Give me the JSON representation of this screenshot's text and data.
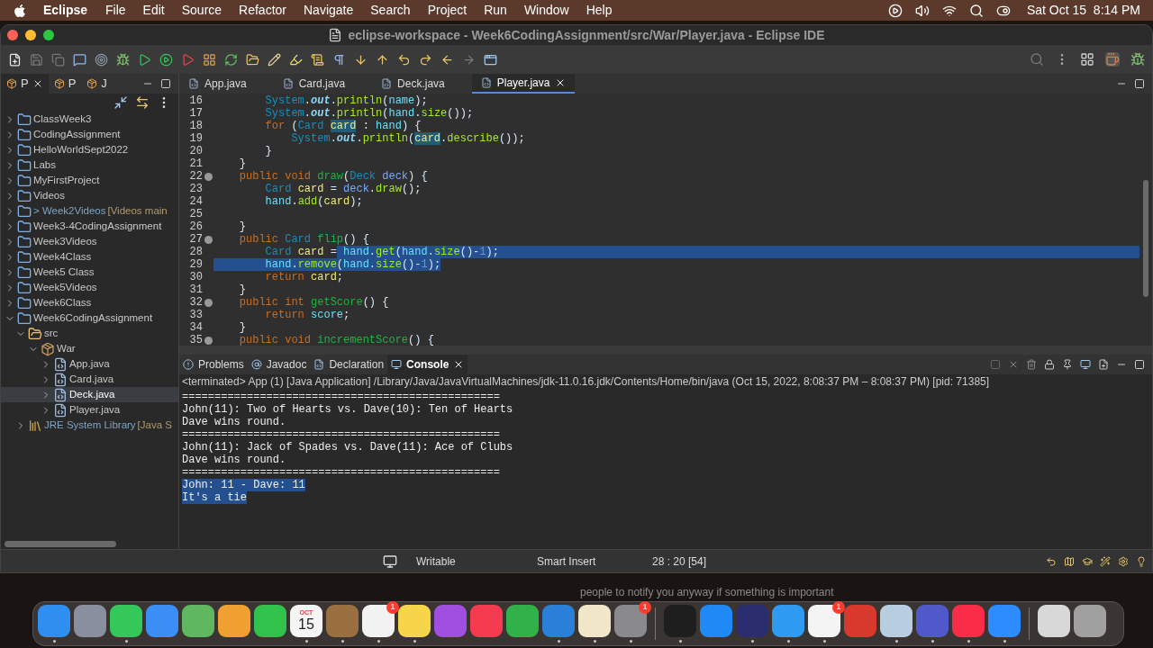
{
  "menu_bar": {
    "app": "Eclipse",
    "items": [
      "File",
      "Edit",
      "Source",
      "Refactor",
      "Navigate",
      "Search",
      "Project",
      "Run",
      "Window",
      "Help"
    ],
    "clock": "Sat Oct 15  8:14 PM"
  },
  "window": {
    "title": "eclipse-workspace - Week6CodingAssignment/src/War/Player.java - Eclipse IDE"
  },
  "side_tabs": [
    {
      "label": "P",
      "selected": true
    },
    {
      "label": "P",
      "selected": false
    },
    {
      "label": "J",
      "selected": false
    }
  ],
  "tree": [
    {
      "label": "ClassWeek3",
      "kind": "project",
      "expanded": false,
      "selected": false
    },
    {
      "label": "CodingAssignment",
      "kind": "project",
      "expanded": false,
      "selected": false
    },
    {
      "label": "HelloWorldSept2022",
      "kind": "project",
      "expanded": false,
      "selected": false
    },
    {
      "label": "Labs",
      "kind": "project",
      "expanded": false,
      "selected": false
    },
    {
      "label": "MyFirstProject",
      "kind": "project",
      "expanded": false,
      "selected": false
    },
    {
      "label": "Videos",
      "kind": "project",
      "expanded": false,
      "selected": false
    },
    {
      "label": "> Week2Videos",
      "decoration": "[Videos main",
      "kind": "project",
      "expanded": false,
      "selected": false
    },
    {
      "label": "Week3-4CodingAssignment",
      "kind": "project",
      "expanded": false,
      "selected": false
    },
    {
      "label": "Week3Videos",
      "kind": "project",
      "expanded": false,
      "selected": false
    },
    {
      "label": "Week4Class",
      "kind": "project",
      "expanded": false,
      "selected": false
    },
    {
      "label": "Week5 Class",
      "kind": "project",
      "expanded": false,
      "selected": false
    },
    {
      "label": "Week5Videos",
      "kind": "project",
      "expanded": false,
      "selected": false
    },
    {
      "label": "Week6Class",
      "kind": "project",
      "expanded": false,
      "selected": false
    },
    {
      "label": "Week6CodingAssignment",
      "kind": "project",
      "expanded": true,
      "selected": false,
      "children": [
        {
          "label": "src",
          "kind": "folder",
          "expanded": true,
          "selected": false,
          "children": [
            {
              "label": "War",
              "kind": "package",
              "expanded": true,
              "selected": false,
              "children": [
                {
                  "label": "App.java",
                  "kind": "java",
                  "expanded": false,
                  "selected": false
                },
                {
                  "label": "Card.java",
                  "kind": "java",
                  "expanded": false,
                  "selected": false
                },
                {
                  "label": "Deck.java",
                  "kind": "java",
                  "expanded": false,
                  "selected": true
                },
                {
                  "label": "Player.java",
                  "kind": "java",
                  "expanded": false,
                  "selected": false
                }
              ]
            }
          ]
        },
        {
          "label": "JRE System Library",
          "decoration": "[Java S",
          "kind": "library",
          "expanded": false,
          "selected": false
        }
      ]
    }
  ],
  "editor_tabs": [
    {
      "label": "App.java",
      "selected": false
    },
    {
      "label": "Card.java",
      "selected": false
    },
    {
      "label": "Deck.java",
      "selected": false
    },
    {
      "label": "Player.java",
      "selected": true
    }
  ],
  "code": [
    {
      "num": "16",
      "fold": false,
      "tokens": [
        {
          "text": "        System",
          "kind": "static"
        },
        {
          "text": ".",
          "kind": "plain"
        },
        {
          "text": "out",
          "kind": "static_field"
        },
        {
          "text": ".",
          "kind": "plain"
        },
        {
          "text": "println",
          "kind": "call"
        },
        {
          "text": "(",
          "kind": "plain"
        },
        {
          "text": "name",
          "kind": "field"
        },
        {
          "text": ");",
          "kind": "plain"
        }
      ]
    },
    {
      "num": "17",
      "fold": false,
      "tokens": [
        {
          "text": "        System",
          "kind": "static"
        },
        {
          "text": ".",
          "kind": "plain"
        },
        {
          "text": "out",
          "kind": "static_field"
        },
        {
          "text": ".",
          "kind": "plain"
        },
        {
          "text": "println",
          "kind": "call"
        },
        {
          "text": "(",
          "kind": "plain"
        },
        {
          "text": "hand",
          "kind": "field"
        },
        {
          "text": ".",
          "kind": "plain"
        },
        {
          "text": "size",
          "kind": "call"
        },
        {
          "text": "());",
          "kind": "plain"
        }
      ]
    },
    {
      "num": "18",
      "fold": false,
      "tokens": [
        {
          "text": "        for",
          "kind": "kw"
        },
        {
          "text": " (",
          "kind": "plain"
        },
        {
          "text": "Card ",
          "kind": "type"
        },
        {
          "text": "card",
          "kind": "local_occ"
        },
        {
          "text": " : ",
          "kind": "plain"
        },
        {
          "text": "hand",
          "kind": "field"
        },
        {
          "text": ") {",
          "kind": "plain"
        }
      ]
    },
    {
      "num": "19",
      "fold": false,
      "tokens": [
        {
          "text": "            System",
          "kind": "static"
        },
        {
          "text": ".",
          "kind": "plain"
        },
        {
          "text": "out",
          "kind": "static_field"
        },
        {
          "text": ".",
          "kind": "plain"
        },
        {
          "text": "println",
          "kind": "call"
        },
        {
          "text": "(",
          "kind": "plain"
        },
        {
          "text": "card",
          "kind": "local_occ"
        },
        {
          "text": ".",
          "kind": "plain"
        },
        {
          "text": "describe",
          "kind": "call"
        },
        {
          "text": "());",
          "kind": "plain"
        }
      ]
    },
    {
      "num": "20",
      "fold": false,
      "tokens": [
        {
          "text": "        }",
          "kind": "plain"
        }
      ]
    },
    {
      "num": "21",
      "fold": false,
      "tokens": [
        {
          "text": "    }",
          "kind": "plain"
        }
      ]
    },
    {
      "num": "22",
      "fold": true,
      "tokens": [
        {
          "text": "    public void ",
          "kind": "kw"
        },
        {
          "text": "draw",
          "kind": "decl"
        },
        {
          "text": "(",
          "kind": "plain"
        },
        {
          "text": "Deck ",
          "kind": "type"
        },
        {
          "text": "deck",
          "kind": "param"
        },
        {
          "text": ") {",
          "kind": "plain"
        }
      ]
    },
    {
      "num": "23",
      "fold": false,
      "tokens": [
        {
          "text": "        Card ",
          "kind": "type"
        },
        {
          "text": "card",
          "kind": "local"
        },
        {
          "text": " = ",
          "kind": "plain"
        },
        {
          "text": "deck",
          "kind": "param"
        },
        {
          "text": ".",
          "kind": "plain"
        },
        {
          "text": "draw",
          "kind": "call"
        },
        {
          "text": "();",
          "kind": "plain"
        }
      ]
    },
    {
      "num": "24",
      "fold": false,
      "tokens": [
        {
          "text": "        hand",
          "kind": "field"
        },
        {
          "text": ".",
          "kind": "plain"
        },
        {
          "text": "add",
          "kind": "call"
        },
        {
          "text": "(",
          "kind": "plain"
        },
        {
          "text": "card",
          "kind": "local"
        },
        {
          "text": ");",
          "kind": "plain"
        }
      ]
    },
    {
      "num": "25",
      "fold": false
    },
    {
      "num": "26",
      "fold": false,
      "tokens": [
        {
          "text": "    }",
          "kind": "plain"
        }
      ]
    },
    {
      "num": "27",
      "fold": true,
      "tokens": [
        {
          "text": "    public ",
          "kind": "kw"
        },
        {
          "text": "Card ",
          "kind": "type"
        },
        {
          "text": "flip",
          "kind": "decl"
        },
        {
          "text": "() {",
          "kind": "plain"
        }
      ]
    },
    {
      "num": "28",
      "fold": false,
      "full_width_selection": true,
      "tokens": [
        {
          "text": "        Card ",
          "kind": "type"
        },
        {
          "text": "card",
          "kind": "local"
        },
        {
          "text": " =",
          "kind": "plain"
        }
      ],
      "selected_tokens": [
        {
          "text": " hand",
          "kind": "field"
        },
        {
          "text": ".",
          "kind": "plain"
        },
        {
          "text": "get",
          "kind": "call"
        },
        {
          "text": "(",
          "kind": "plain"
        },
        {
          "text": "hand",
          "kind": "field"
        },
        {
          "text": ".",
          "kind": "plain"
        },
        {
          "text": "size",
          "kind": "call"
        },
        {
          "text": "()-",
          "kind": "plain"
        },
        {
          "text": "1",
          "kind": "num"
        },
        {
          "text": ");",
          "kind": "plain"
        }
      ]
    },
    {
      "num": "29",
      "fold": false,
      "full_width_selection": false,
      "selected_tokens": [
        {
          "text": "        hand",
          "kind": "field"
        },
        {
          "text": ".",
          "kind": "plain"
        },
        {
          "text": "remove",
          "kind": "call"
        },
        {
          "text": "(",
          "kind": "plain"
        },
        {
          "text": "hand",
          "kind": "field"
        },
        {
          "text": ".",
          "kind": "plain"
        },
        {
          "text": "size",
          "kind": "call"
        },
        {
          "text": "()-",
          "kind": "plain"
        },
        {
          "text": "1",
          "kind": "num"
        },
        {
          "text": ");",
          "kind": "plain"
        }
      ]
    },
    {
      "num": "30",
      "fold": false,
      "tokens": [
        {
          "text": "        return ",
          "kind": "kw"
        },
        {
          "text": "card",
          "kind": "local"
        },
        {
          "text": ";",
          "kind": "plain"
        }
      ]
    },
    {
      "num": "31",
      "fold": false,
      "tokens": [
        {
          "text": "    }",
          "kind": "plain"
        }
      ]
    },
    {
      "num": "32",
      "fold": true,
      "tokens": [
        {
          "text": "    public int ",
          "kind": "kw"
        },
        {
          "text": "getScore",
          "kind": "decl"
        },
        {
          "text": "() {",
          "kind": "plain"
        }
      ]
    },
    {
      "num": "33",
      "fold": false,
      "tokens": [
        {
          "text": "        return ",
          "kind": "kw"
        },
        {
          "text": "score",
          "kind": "field"
        },
        {
          "text": ";",
          "kind": "plain"
        }
      ]
    },
    {
      "num": "34",
      "fold": false,
      "tokens": [
        {
          "text": "    }",
          "kind": "plain"
        }
      ]
    },
    {
      "num": "35",
      "fold": true,
      "tokens": [
        {
          "text": "    public void ",
          "kind": "kw"
        },
        {
          "text": "incrementScore",
          "kind": "decl"
        },
        {
          "text": "() {",
          "kind": "plain"
        }
      ]
    }
  ],
  "bottom_tabs": [
    {
      "label": "Problems",
      "selected": false
    },
    {
      "label": "Javadoc",
      "selected": false
    },
    {
      "label": "Declaration",
      "selected": false
    },
    {
      "label": "Console",
      "selected": true
    }
  ],
  "console": {
    "header": "<terminated> App (1) [Java Application] /Library/Java/JavaVirtualMachines/jdk-11.0.16.jdk/Contents/Home/bin/java  (Oct 15, 2022, 8:08:37 PM – 8:08:37 PM) [pid: 71385]",
    "lines": [
      {
        "text": "=================================================",
        "selected": false
      },
      {
        "text": "John(11): Two of Hearts vs. Dave(10): Ten of Hearts",
        "selected": false
      },
      {
        "text": "Dave wins round.",
        "selected": false
      },
      {
        "text": "=================================================",
        "selected": false
      },
      {
        "text": "John(11): Jack of Spades vs. Dave(11): Ace of Clubs",
        "selected": false
      },
      {
        "text": "Dave wins round.",
        "selected": false
      },
      {
        "text": "=================================================",
        "selected": false
      },
      {
        "text": "John: 11 - Dave: 11",
        "selected": true
      },
      {
        "text": "It's a tie",
        "selected": true
      }
    ]
  },
  "status_bar": {
    "mode": "Writable",
    "insert": "Smart Insert",
    "position": "28 : 20 [54]"
  },
  "background_text": "people to notify you anyway if something is important",
  "dock": [
    {
      "color": "#2f8ff0",
      "running": true
    },
    {
      "color": "#8a8fa0",
      "running": false
    },
    {
      "color": "#34c759",
      "running": true
    },
    {
      "color": "#3a8ef5",
      "running": false
    },
    {
      "color": "#5fb760",
      "running": false
    },
    {
      "color": "#f0a030",
      "running": false
    },
    {
      "color": "#30c24a",
      "running": false
    },
    {
      "color": "#f5f5f5",
      "running": true,
      "month": "OCT",
      "day": "15"
    },
    {
      "color": "#9a7040",
      "running": true
    },
    {
      "color": "#f2f2f2",
      "running": true,
      "badge": "1"
    },
    {
      "color": "#f7d54a",
      "running": true
    },
    {
      "color": "#a050e0",
      "running": false
    },
    {
      "color": "#f53b4f",
      "running": false
    },
    {
      "color": "#30b14a",
      "running": false
    },
    {
      "color": "#2a7fd8",
      "running": true
    },
    {
      "color": "#f2e6c8",
      "running": true
    },
    {
      "color": "#8a8a8e",
      "running": true,
      "badge": "1"
    },
    {
      "color": "#1e1e1e",
      "running": true
    },
    {
      "color": "#1f8af5",
      "running": false
    },
    {
      "color": "#2c2d6e",
      "running": true
    },
    {
      "color": "#2f9af2",
      "running": true
    },
    {
      "color": "#f4f4f4",
      "running": true,
      "badge": "1"
    },
    {
      "color": "#d8392c",
      "running": false
    },
    {
      "color": "#b8cde0",
      "running": true
    },
    {
      "color": "#5059c9",
      "running": true
    },
    {
      "color": "#fa2d48",
      "running": true
    },
    {
      "color": "#2d8cff",
      "running": true
    },
    {
      "color": "#d8d8d8",
      "running": false
    },
    {
      "color": "#a0a0a0",
      "running": false
    }
  ]
}
